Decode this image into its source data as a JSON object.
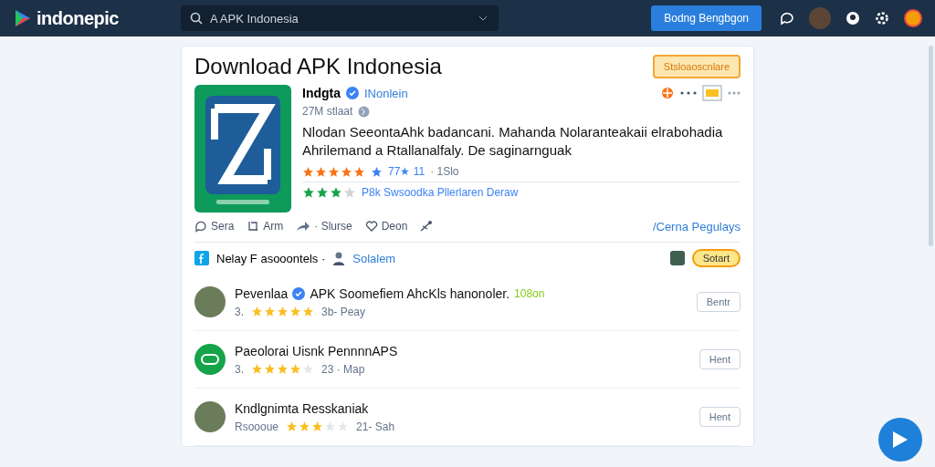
{
  "topbar": {
    "logo": "indonepic",
    "search": {
      "value": "A APK Indonesia"
    },
    "button": "Bodng Bengbgon"
  },
  "card": {
    "title": "Download APK Indonesia",
    "action": "Stsloaoscnlare",
    "app": {
      "name": "Indgta",
      "verified": true,
      "publisher": "INonlein",
      "meta": "27M stlaat",
      "description": "Nlodan SeeontaAhk badancani. Mahanda Nolaranteakaii elrabohadia Ahrilemand a Rtallanalfaly. De saginarnguak",
      "stars": 5,
      "rating_text": "77★ 11",
      "rating_extra": "· 1Slo"
    },
    "review": {
      "stars": 3,
      "text": "P8k Swsoodka Pllerlaren Deraw"
    },
    "actions": [
      {
        "kind": "comment",
        "label": "Sera"
      },
      {
        "kind": "repost",
        "label": "Arm"
      },
      {
        "kind": "forward",
        "label": "· Slurse"
      },
      {
        "kind": "like",
        "label": "Deon"
      },
      {
        "kind": "share"
      }
    ],
    "actions_link": "/Cerna Pegulays"
  },
  "section": {
    "label": "Nelay F asooontels ·",
    "user": "Solalem",
    "button": "Sotart"
  },
  "rows": [
    {
      "title": "Pevenlaa",
      "verified": true,
      "title_rest": "APK Soomefiem AhcKls hanonoler.",
      "tag": "108on",
      "prefix": "3.",
      "stars": 5,
      "info": "3b- Peay",
      "button": "Bentr",
      "kind": "photo"
    },
    {
      "title": "Paeolorai Uisnk PennnnAPS",
      "verified": false,
      "prefix": "3.",
      "stars": 4,
      "info": "23 · Map",
      "button": "Hent",
      "kind": "logo"
    },
    {
      "title": "Kndlgnimta Resskaniak",
      "verified": false,
      "prefix": "Rsoooue",
      "stars": 3,
      "info": "21- Sah",
      "button": "Hent",
      "kind": "photo"
    }
  ]
}
